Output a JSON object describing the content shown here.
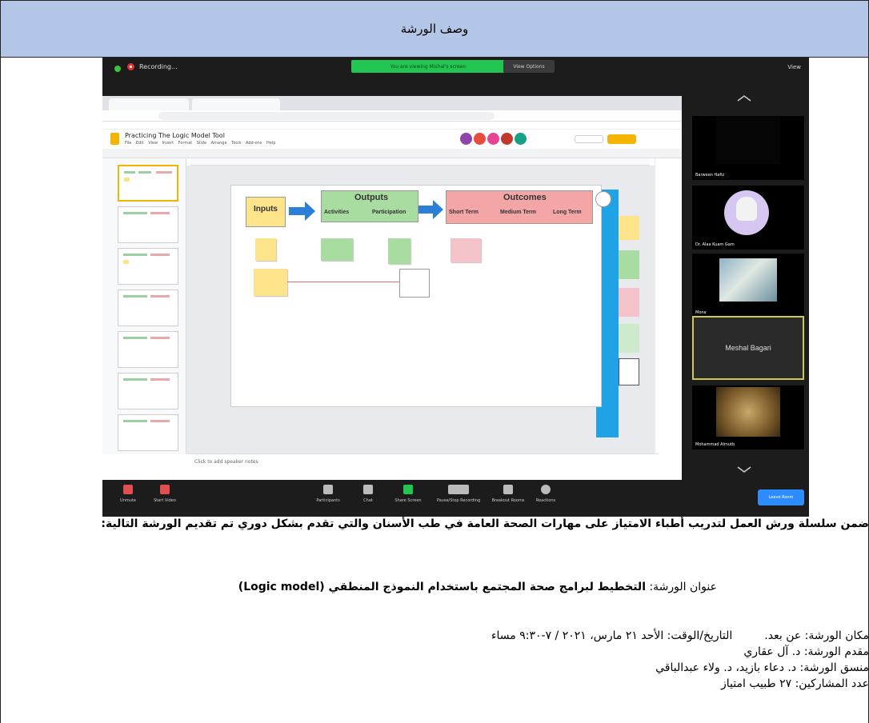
{
  "header": {
    "title": "وصف الورشة"
  },
  "screenshot": {
    "recording_label": "Recording...",
    "share_banner": "You are viewing Mishal's screen",
    "view_options": "View Options",
    "view_label": "View",
    "doc_title": "Practicing The Logic Model Tool",
    "menu": "File  Edit  View  Insert  Format  Slide  Arrange  Tools  Add-ons  Help",
    "notes_placeholder": "Click to add speaker notes",
    "logic_model": {
      "inputs": "Inputs",
      "outputs": "Outputs",
      "outputs_sub": [
        "Activities",
        "Participation"
      ],
      "outcomes": "Outcomes",
      "outcomes_sub": [
        "Short Term",
        "Medium Term",
        "Long Term"
      ]
    },
    "participants": [
      {
        "name": "Barween Hafiz"
      },
      {
        "name": "Dr. Alaa Kuam Gam"
      },
      {
        "name": "Mona"
      },
      {
        "name": "Meshal Bagari"
      },
      {
        "name": "Mohammad Almutb"
      }
    ],
    "bottom_bar": [
      "Unmute",
      "Start Video",
      "Participants",
      "Chat",
      "Share Screen",
      "Pause/Stop Recording",
      "Breakout Rooms",
      "Reactions"
    ],
    "leave_button": "Leave Room"
  },
  "body": {
    "intro": "ضمن سلسلة ورش العمل لتدريب أطباء الامتياز على مهارات الصحة العامة في طب الأسنان والتي تقدم بشكل دوري تم تقديم الورشة التالية:",
    "workshop_title_label": "عنوان الورشة:",
    "workshop_title_value": "التخطيط لبرامج صحة المجتمع باستخدام النموذج المنطقي (Logic model)",
    "location": "مكان الورشة: عن بعد.",
    "datetime": "التاريخ/الوقت: الأحد ٢١ مارس، ٢٠٢١ / ٧-٩:٣٠ مساء",
    "presenter": "مقدم الورشة: د. آل عقاري",
    "coordinators": "منسق الورشة: د. دعاء بازيد، د. ولاء عبدالباقي",
    "attendees": "عدد المشاركين: ٢٧ طبيب امتياز"
  },
  "colors": {
    "header_bg": "#b4c6e7",
    "inputs_box": "#fde38a",
    "outputs_box": "#a9dca0",
    "outcomes_box": "#f4a6a6",
    "arrow": "#2b7fd6",
    "zoom_green": "#23c552",
    "leave_blue": "#2d8cff"
  }
}
